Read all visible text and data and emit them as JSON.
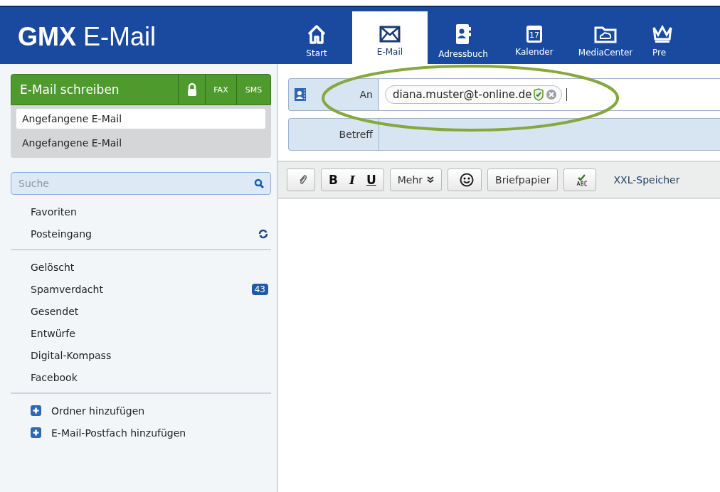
{
  "header": {
    "logo_bold": "GMX",
    "logo_text": "E-Mail"
  },
  "tabs": [
    {
      "label": "Start",
      "selected": false
    },
    {
      "label": "E-Mail",
      "selected": true
    },
    {
      "label": "Adressbuch",
      "selected": false
    },
    {
      "label": "Kalender",
      "selected": false
    },
    {
      "label": "MediaCenter",
      "selected": false
    },
    {
      "label": "Pre",
      "selected": false
    }
  ],
  "calendar_day": "17",
  "compose": {
    "label": "E-Mail schreiben",
    "fax": "FAX",
    "sms": "SMS"
  },
  "drafts": [
    {
      "label": "Angefangene E-Mail",
      "selected": true
    },
    {
      "label": "Angefangene E-Mail",
      "selected": false
    }
  ],
  "search": {
    "placeholder": "Suche"
  },
  "folder_groups": [
    [
      {
        "label": "Favoriten",
        "sync": false
      },
      {
        "label": "Posteingang",
        "sync": true
      }
    ],
    [
      {
        "label": "Gelöscht",
        "sync": false
      },
      {
        "label": "Spamverdacht",
        "sync": false,
        "badge": "43"
      },
      {
        "label": "Gesendet",
        "sync": false
      },
      {
        "label": "Entwürfe",
        "sync": false
      },
      {
        "label": "Digital-Kompass",
        "sync": false
      },
      {
        "label": "Facebook",
        "sync": false
      }
    ]
  ],
  "add_actions": [
    "Ordner hinzufügen",
    "E-Mail-Postfach hinzufügen"
  ],
  "to": {
    "label": "An",
    "recipient": "diana.muster@t-online.de",
    "verified": true
  },
  "subject": {
    "label": "Betreff"
  },
  "toolbar": {
    "format": [
      "B",
      "I",
      "U"
    ],
    "more": "Mehr",
    "stationery": "Briefpapier",
    "storage_link": "XXL-Speicher"
  }
}
